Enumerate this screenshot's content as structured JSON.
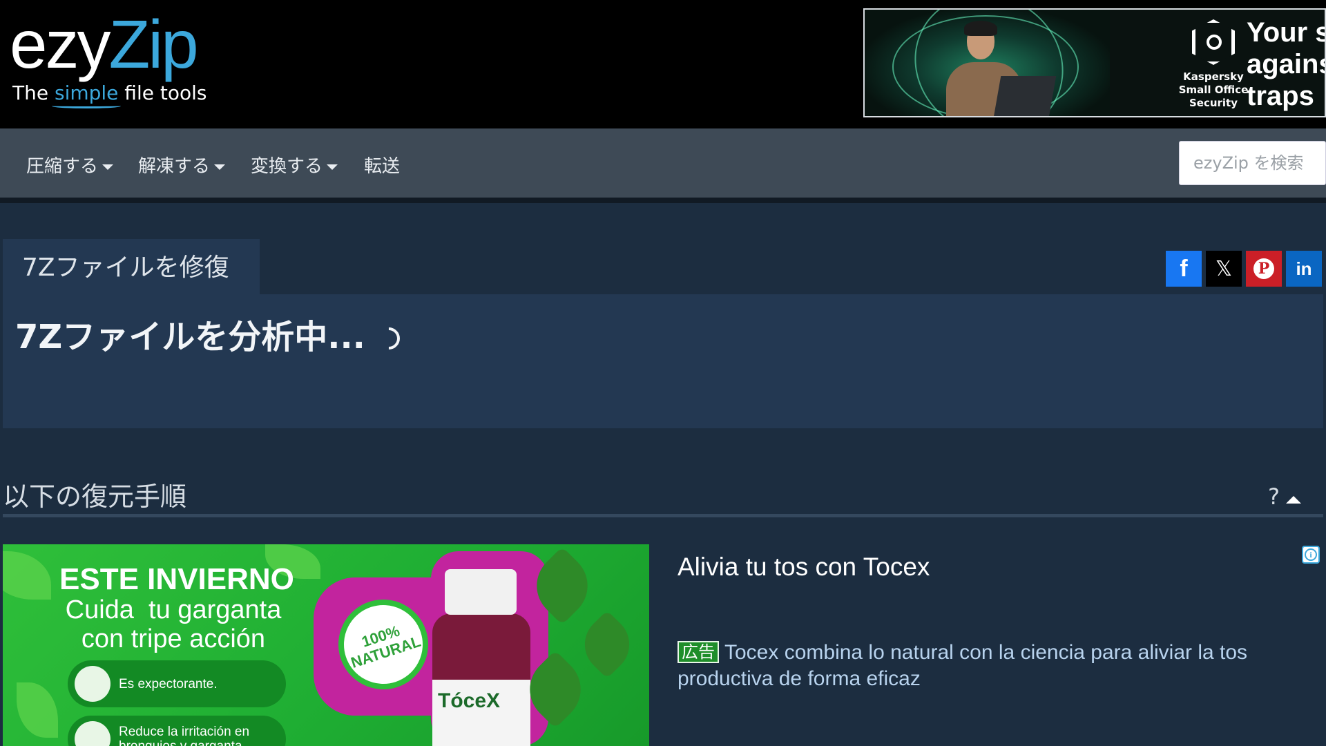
{
  "logo": {
    "ezy": "ezy",
    "zip": "Zip",
    "tag_pre": "The ",
    "tag_simple": "simple",
    "tag_post": " file tools"
  },
  "top_ad": {
    "brand_lines": [
      "Kaspersky",
      "Small Office",
      "Security"
    ],
    "headline": "Your s\nagains\ntraps"
  },
  "nav": {
    "items": [
      {
        "label": "圧縮する",
        "dropdown": true
      },
      {
        "label": "解凍する",
        "dropdown": true
      },
      {
        "label": "変換する",
        "dropdown": true
      },
      {
        "label": "転送",
        "dropdown": false
      }
    ],
    "search_placeholder": "ezyZip を検索"
  },
  "tab": {
    "label": "7Zファイルを修復"
  },
  "share": {
    "facebook": "f",
    "x": "𝕏",
    "pinterest": "P",
    "linkedin": "in"
  },
  "status": {
    "text": "7Zファイルを分析中..."
  },
  "section": {
    "title": "以下の復元手順",
    "help": "?"
  },
  "bottom_ad": {
    "image": {
      "headline1": "ESTE INVIERNO",
      "headline2": "Cuida  tu garganta\ncon tripe acción",
      "bullets": [
        "Es expectorante.",
        "Reduce la irritación en bronquios y garganta"
      ],
      "badge": "100%\nNATURAL",
      "brand": "TóceX"
    },
    "title": "Alivia tu tos con Tocex",
    "tag": "広告",
    "copy": "Tocex combina lo natural con la ciencia para aliviar la tos productiva de forma eficaz",
    "info": "i"
  },
  "colors": {
    "accent": "#3ca8dc",
    "nav_bg": "#3e4a56",
    "page_bg": "#1c2d40",
    "panel_bg": "#233852"
  }
}
